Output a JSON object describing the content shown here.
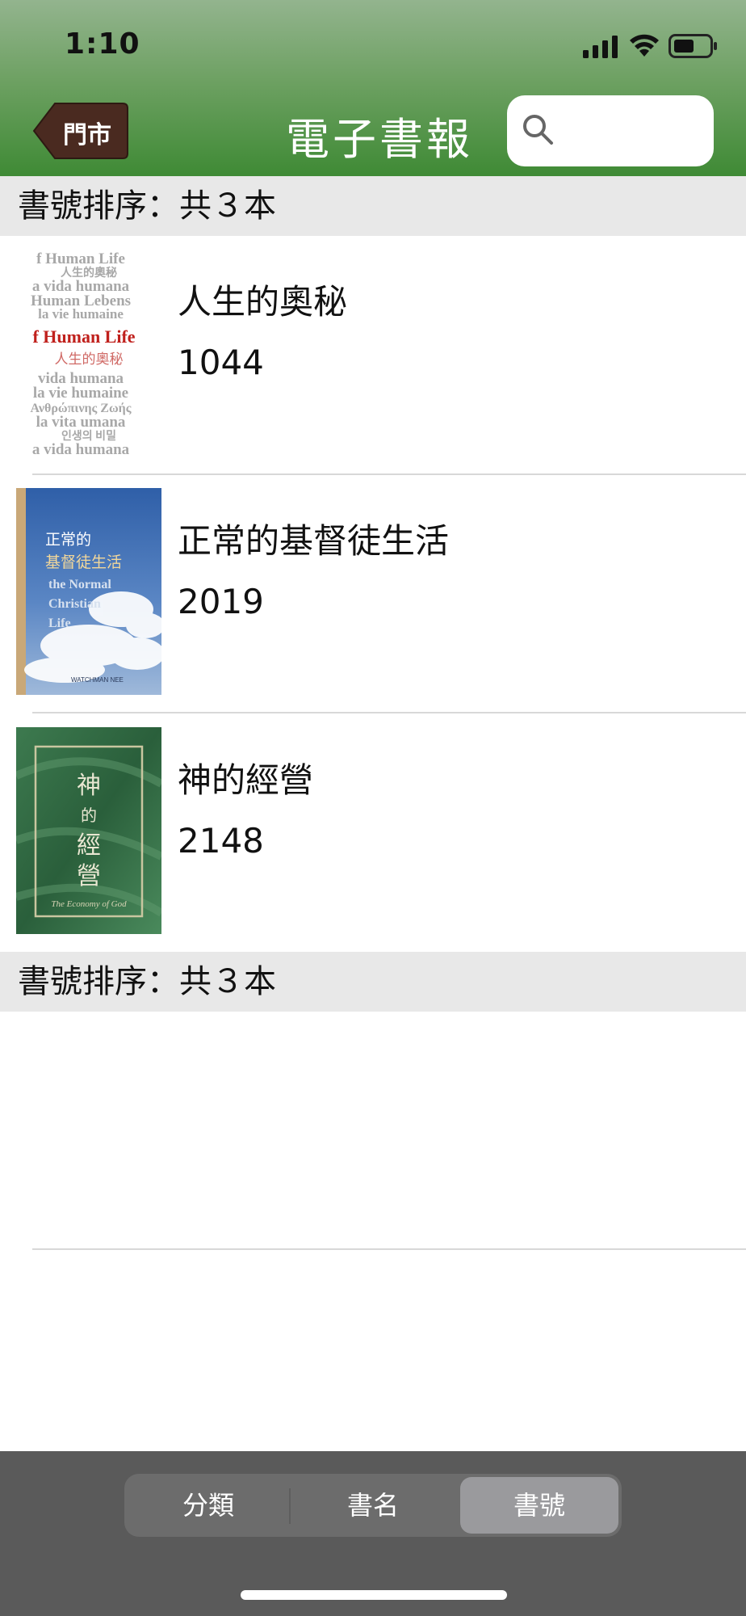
{
  "status_bar": {
    "time": "1:10"
  },
  "nav": {
    "back_label": "門市",
    "title": "電子書報",
    "search_placeholder": ""
  },
  "section_top": {
    "label": "書號排序：共３本"
  },
  "section_bottom": {
    "label": "書號排序：共３本"
  },
  "books": [
    {
      "title": "人生的奧秘",
      "number": "1044",
      "cover": {
        "lines": [
          "f Human Life",
          "人生的奧秘",
          "a vida humana",
          "Human Lebens",
          "la vie humaine",
          "f Human Life",
          "人生的奧秘",
          "vida humana",
          "la vie humaine",
          "Ανθρώπινης Ζωής",
          "la vita umana",
          "인생의 비밀",
          "a vida humana"
        ],
        "highlight": "f Human Life",
        "highlight_sub": "人生的奧秘",
        "colors": {
          "text": "#9a9a9a",
          "accent": "#c0201c"
        }
      }
    },
    {
      "title": "正常的基督徒生活",
      "number": "2019",
      "cover": {
        "line1": "正常的",
        "line2": "基督徒生活",
        "english": [
          "the Normal",
          "Christian",
          "Life"
        ],
        "author": "WATCHMAN NEE",
        "colors": {
          "sky": "#3b6db3",
          "title": "#ffffff",
          "title2": "#f2d79a"
        }
      }
    },
    {
      "title": "神的經營",
      "number": "2148",
      "cover": {
        "vertical": "神的經營",
        "english": "The Economy of God",
        "colors": {
          "bg": "#2f6b43",
          "frame": "#c9c6a0",
          "text": "#e9e7d2"
        }
      }
    }
  ],
  "tabs": [
    {
      "label": "分類",
      "active": false
    },
    {
      "label": "書名",
      "active": false
    },
    {
      "label": "書號",
      "active": true
    }
  ],
  "colors": {
    "header_green": "#3f8a35",
    "back_button": "#4a2a20",
    "section_bg": "#e8e8e8",
    "bottom_bar": "#5a5a5a"
  }
}
